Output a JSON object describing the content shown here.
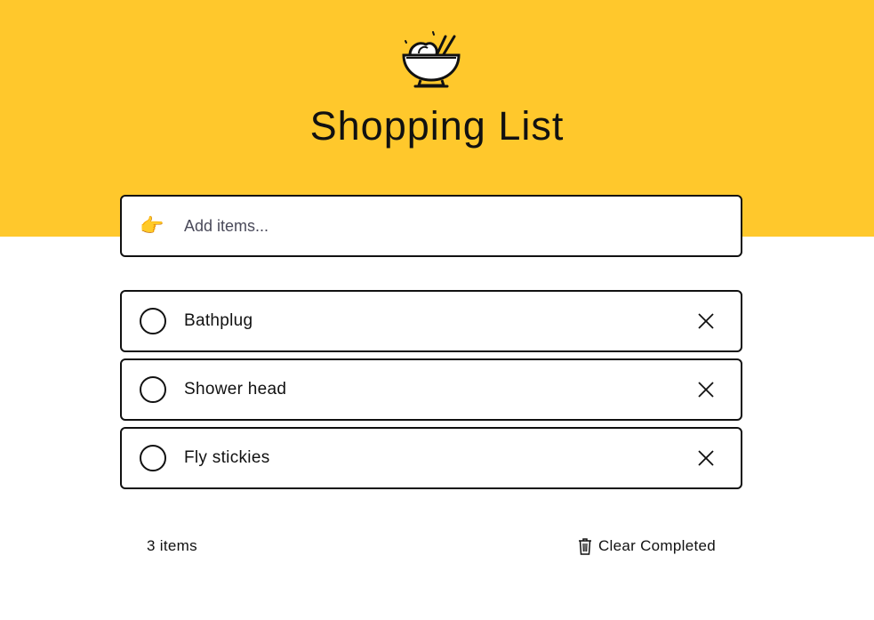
{
  "header": {
    "title": "Shopping List",
    "logo_icon": "noodle-bowl-icon",
    "background_color": "#FFC82C"
  },
  "add_item": {
    "icon": "pointing-hand-icon",
    "icon_glyph": "👉",
    "placeholder": "Add items...",
    "value": ""
  },
  "items": [
    {
      "label": "Bathplug",
      "completed": false
    },
    {
      "label": "Shower head",
      "completed": false
    },
    {
      "label": "Fly stickies",
      "completed": false
    }
  ],
  "footer": {
    "count_text": "3 items",
    "clear_label": "Clear Completed",
    "clear_icon": "trash-icon"
  }
}
